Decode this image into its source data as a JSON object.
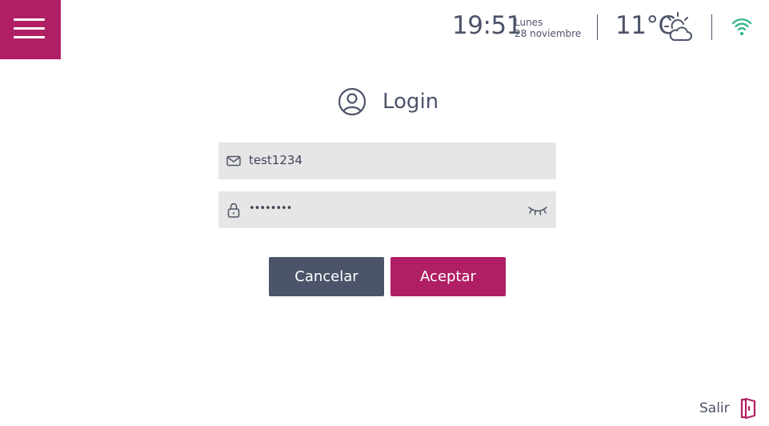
{
  "header": {
    "menu_icon": "hamburger-menu-icon",
    "time": "19:51",
    "day": "Lunes",
    "date": "28 noviembre",
    "temperature": "11°C",
    "weather_icon": "partly-cloudy-icon",
    "wifi_icon": "wifi-icon"
  },
  "login": {
    "title": "Login",
    "title_icon": "user-circle-icon",
    "username_value": "test1234",
    "username_icon": "envelope-icon",
    "password_value": "••••••••",
    "password_icon": "lock-icon",
    "visibility_icon": "eye-closed-icon"
  },
  "buttons": {
    "cancel_label": "Cancelar",
    "accept_label": "Aceptar"
  },
  "footer": {
    "exit_label": "Salir",
    "exit_icon": "exit-door-icon"
  },
  "colors": {
    "accent": "#b01f63",
    "secondary": "#4c5469",
    "field_bg": "#e6e6e6",
    "wifi": "#2bb28a"
  }
}
